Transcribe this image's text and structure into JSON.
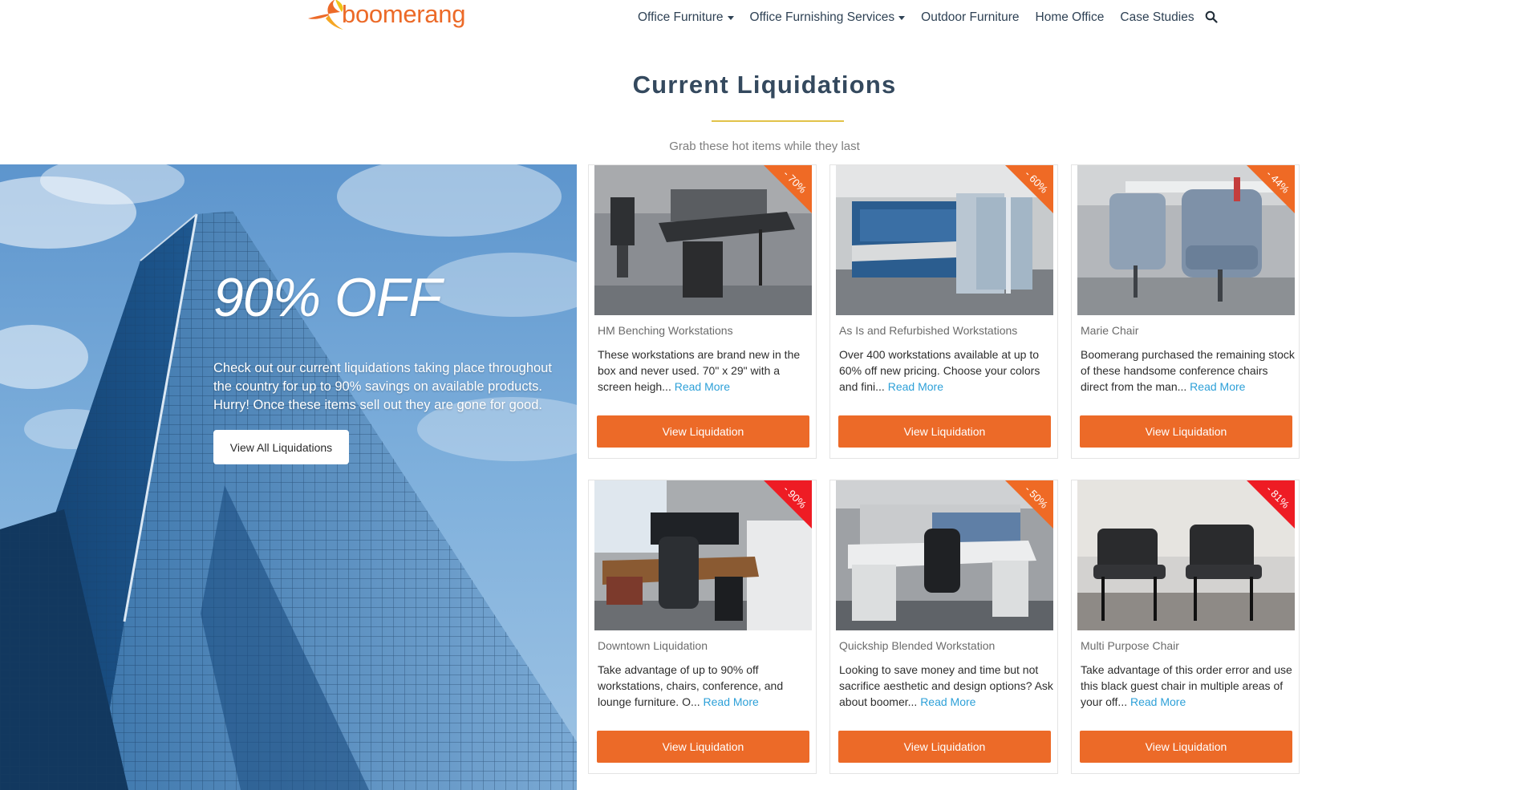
{
  "header": {
    "logo_text": "boomerang",
    "nav": [
      {
        "label": "Office Furniture",
        "dropdown": true
      },
      {
        "label": "Office Furnishing Services",
        "dropdown": true
      },
      {
        "label": "Outdoor Furniture",
        "dropdown": false
      },
      {
        "label": "Home Office",
        "dropdown": false
      },
      {
        "label": "Case Studies",
        "dropdown": false
      }
    ],
    "search_icon": "search-icon"
  },
  "section": {
    "title": "Current Liquidations",
    "subtitle": "Grab these hot items while they last"
  },
  "hero": {
    "headline": "90% OFF",
    "text": "Check out our current liquidations taking place throughout the country for up to 90% savings on available products. Hurry! Once these items sell out they are gone for good.",
    "button_label": "View All Liquidations"
  },
  "cards": [
    {
      "name": "HM Benching Workstations",
      "discount": "- 70%",
      "description": "These workstations are brand new in the box and never used.  70\" x 29\" with a screen heigh...",
      "read_more": "Read More",
      "button_label": "View Liquidation"
    },
    {
      "name": "As Is and Refurbished Workstations",
      "discount": "- 60%",
      "description": "Over 400 workstations available at up to 60% off new pricing.  Choose your colors and fini...",
      "read_more": "Read More",
      "button_label": "View Liquidation"
    },
    {
      "name": "Marie Chair",
      "discount": "- 44%",
      "description": "Boomerang purchased the remaining stock of these handsome conference chairs direct from the man...",
      "read_more": "Read More",
      "button_label": "View Liquidation"
    },
    {
      "name": "Downtown Liquidation",
      "discount": "- 90%",
      "description": "Take advantage of up to 90% off workstations, chairs, conference, and lounge furniture.  O...",
      "read_more": "Read More",
      "button_label": "View Liquidation"
    },
    {
      "name": "Quickship Blended Workstation",
      "discount": "- 50%",
      "description": "Looking to save money and time but not sacrifice aesthetic and design options?  Ask about boomer...",
      "read_more": "Read More",
      "button_label": "View Liquidation"
    },
    {
      "name": "Multi Purpose Chair",
      "discount": "- 81%",
      "description": "Take advantage of this order error and use this black guest chair in multiple areas of your off...",
      "read_more": "Read More",
      "button_label": "View Liquidation"
    }
  ],
  "colors": {
    "brand_orange": "#ec6a28",
    "ribbon_red": "#ee1c24",
    "title_navy": "#34495e",
    "link_blue": "#2da0d8",
    "accent_gold": "#e2c349"
  }
}
